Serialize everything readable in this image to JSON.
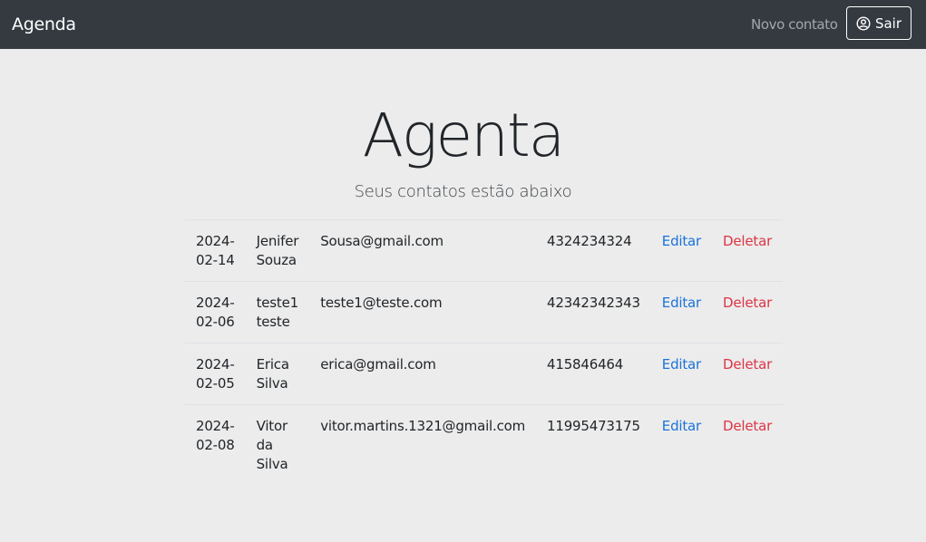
{
  "navbar": {
    "brand": "Agenda",
    "new_contact": "Novo contato",
    "logout_label": "Sair",
    "logout_icon": "user-circle-icon"
  },
  "hero": {
    "title": "Agenta",
    "subtitle": "Seus contatos estão abaixo"
  },
  "contacts": [
    {
      "date": "2024-02-14",
      "name": "Jenifer Souza",
      "email": "Sousa@gmail.com",
      "phone": "4324234324",
      "edit": "Editar",
      "delete": "Deletar"
    },
    {
      "date": "2024-02-06",
      "name": "teste1 teste",
      "email": "teste1@teste.com",
      "phone": "42342342343",
      "edit": "Editar",
      "delete": "Deletar"
    },
    {
      "date": "2024-02-05",
      "name": "Erica Silva",
      "email": "erica@gmail.com",
      "phone": "415846464",
      "edit": "Editar",
      "delete": "Deletar"
    },
    {
      "date": "2024-02-08",
      "name": "Vitor da Silva",
      "email": "vitor.martins.1321@gmail.com",
      "phone": "11995473175",
      "edit": "Editar",
      "delete": "Deletar"
    }
  ],
  "colors": {
    "navbar_bg": "#343a40",
    "page_bg": "#ececec",
    "link_edit": "#1a73d9",
    "link_delete": "#dc3545"
  }
}
